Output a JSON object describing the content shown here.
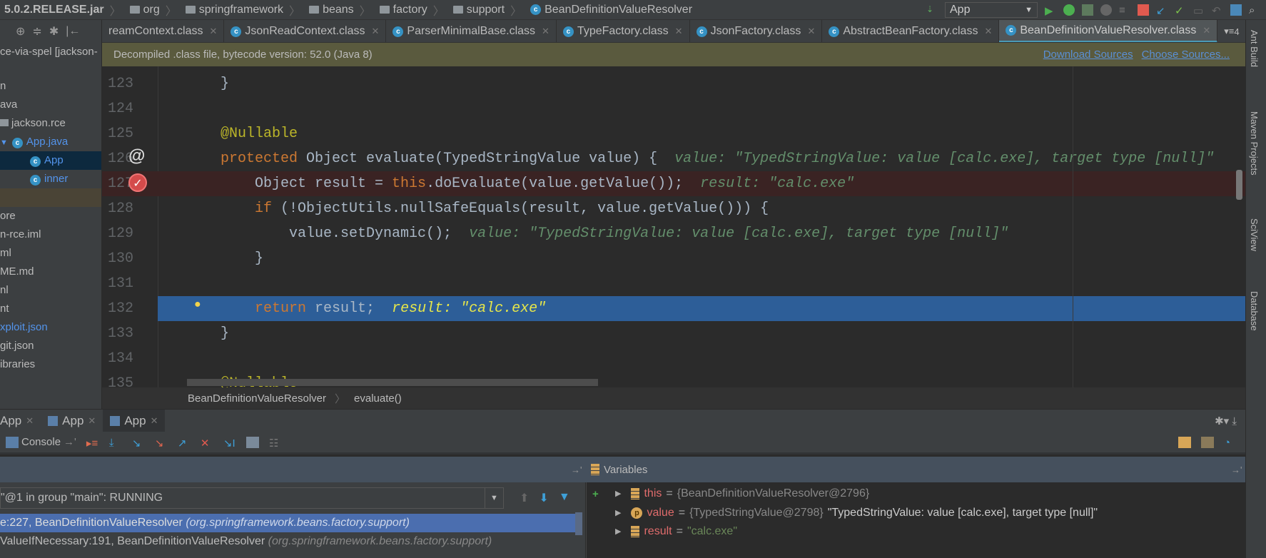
{
  "breadcrumb": [
    "5.0.2.RELEASE.jar",
    "org",
    "springframework",
    "beans",
    "factory",
    "support",
    "BeanDefinitionValueResolver"
  ],
  "run_config": "App",
  "project": {
    "root": "ce-via-spel [jackson-",
    "items": [
      "n",
      "ava",
      "jackson.rce",
      "App.java",
      "App",
      "inner",
      "",
      "ore",
      "n-rce.iml",
      "ml",
      "ME.md",
      "nl",
      "nt",
      "xploit.json",
      "git.json",
      "ibraries"
    ]
  },
  "tabs": [
    "reamContext.class",
    "JsonReadContext.class",
    "ParserMinimalBase.class",
    "TypeFactory.class",
    "JsonFactory.class",
    "AbstractBeanFactory.class",
    "BeanDefinitionValueResolver.class"
  ],
  "tab_overflow": "4",
  "notice": {
    "text": "Decompiled .class file, bytecode version: 52.0 (Java 8)",
    "download": "Download Sources",
    "choose": "Choose Sources..."
  },
  "code": [
    {
      "n": "123",
      "parts": [
        [
          "",
          "}"
        ]
      ]
    },
    {
      "n": "124",
      "parts": []
    },
    {
      "n": "125",
      "parts": [
        [
          "",
          "@Nullable"
        ]
      ]
    },
    {
      "n": "126",
      "parts": [
        [
          "kw",
          "protected"
        ],
        [
          "",
          " Object evaluate(TypedStringValue value) {  "
        ],
        [
          "hint",
          "value: \"TypedStringValue: value [calc.exe], target type [null]\""
        ]
      ]
    },
    {
      "n": "127",
      "parts": [
        [
          "",
          "    Object result = "
        ],
        [
          "kw",
          "this"
        ],
        [
          "",
          ".doEvaluate(value.getValue());  "
        ],
        [
          "hint",
          "result: \"calc.exe\""
        ]
      ]
    },
    {
      "n": "128",
      "parts": [
        [
          "kw",
          "    if"
        ],
        [
          "",
          " (!ObjectUtils.nullSafeEquals(result, value.getValue())) {"
        ]
      ]
    },
    {
      "n": "129",
      "parts": [
        [
          "",
          "        value.setDynamic();  "
        ],
        [
          "hint",
          "value: \"TypedStringValue: value [calc.exe], target type [null]\""
        ]
      ]
    },
    {
      "n": "130",
      "parts": [
        [
          "",
          "    }"
        ]
      ]
    },
    {
      "n": "131",
      "parts": []
    },
    {
      "n": "132",
      "parts": [
        [
          "kw",
          "    return"
        ],
        [
          "",
          " result;  "
        ],
        [
          "hint",
          "result: \"calc.exe\""
        ]
      ]
    },
    {
      "n": "133",
      "parts": [
        [
          "",
          "}"
        ]
      ]
    },
    {
      "n": "134",
      "parts": []
    },
    {
      "n": "135",
      "parts": [
        [
          "",
          "@Nullable"
        ]
      ]
    }
  ],
  "editor_breadcrumb": {
    "class": "BeanDefinitionValueResolver",
    "method": "evaluate()"
  },
  "right_tools": [
    "Ant Build",
    "Maven Projects",
    "SciView",
    "Database"
  ],
  "debug_tabs": [
    "App",
    "App",
    "App"
  ],
  "console_label": "Console",
  "variables_label": "Variables",
  "thread": "\"@1 in group \"main\": RUNNING",
  "frames": [
    {
      "text": "e:227, BeanDefinitionValueResolver ",
      "pkg": "(org.springframework.beans.factory.support)"
    },
    {
      "text": "ValueIfNecessary:191, BeanDefinitionValueResolver ",
      "pkg": "(org.springframework.beans.factory.support)"
    }
  ],
  "variables": [
    {
      "name": "this",
      "val": "{BeanDefinitionValueResolver@2796}",
      "text": ""
    },
    {
      "name": "value",
      "val": "{TypedStringValue@2798}",
      "text": "\"TypedStringValue: value [calc.exe], target type [null]\""
    },
    {
      "name": "result",
      "str": "\"calc.exe\""
    }
  ]
}
